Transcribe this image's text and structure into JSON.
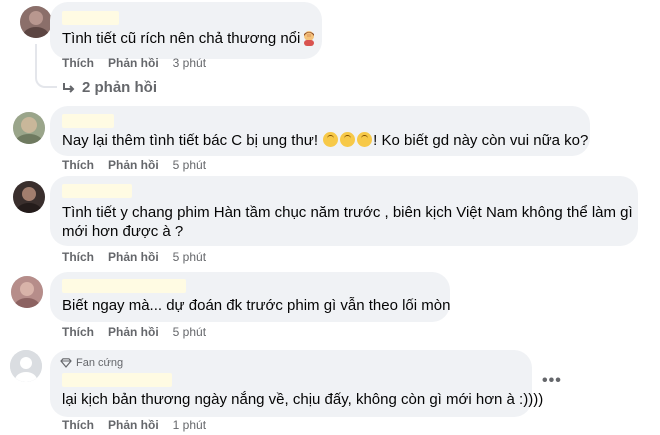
{
  "comments": [
    {
      "text": "Tình tiết cũ rích nên chả thương nổi",
      "emoji": "woman-facepalming-emoji",
      "like": "Thích",
      "reply": "Phản hồi",
      "time": "3 phút"
    },
    {
      "text_before": "Nay lại thêm tình tiết bác C bị ung thư! ",
      "emoji": "upside-down-face-emoji",
      "text_after": "! Ko biết gd này còn vui nữa ko?",
      "like": "Thích",
      "reply": "Phản hồi",
      "time": "5 phút"
    },
    {
      "line1": "Tình tiết y chang phim Hàn tầm chục năm trước , biên kịch Việt Nam không thể làm gì",
      "line2": "mới hơn được à ?",
      "like": "Thích",
      "reply": "Phản hồi",
      "time": "5 phút"
    },
    {
      "text": "Biết ngay mà... dự đoán đk trước phim gì vẫn theo lối mòn",
      "like": "Thích",
      "reply": "Phản hồi",
      "time": "5 phút"
    },
    {
      "badge": "Fan cứng",
      "text": "lại kịch bản thương ngày nắng về, chịu đấy, không còn gì mới hơn à :))))",
      "like": "Thích",
      "reply": "Phản hồi",
      "time": "1 phút",
      "more": "•••"
    }
  ],
  "replies_link": {
    "icon": "reply-arrow-icon",
    "label": "2 phản hồi"
  },
  "colors": {
    "bubble": "#f0f2f5",
    "meta_text": "#65676b",
    "name_blur": "#fffbe3",
    "emoji": "#f7c948"
  }
}
